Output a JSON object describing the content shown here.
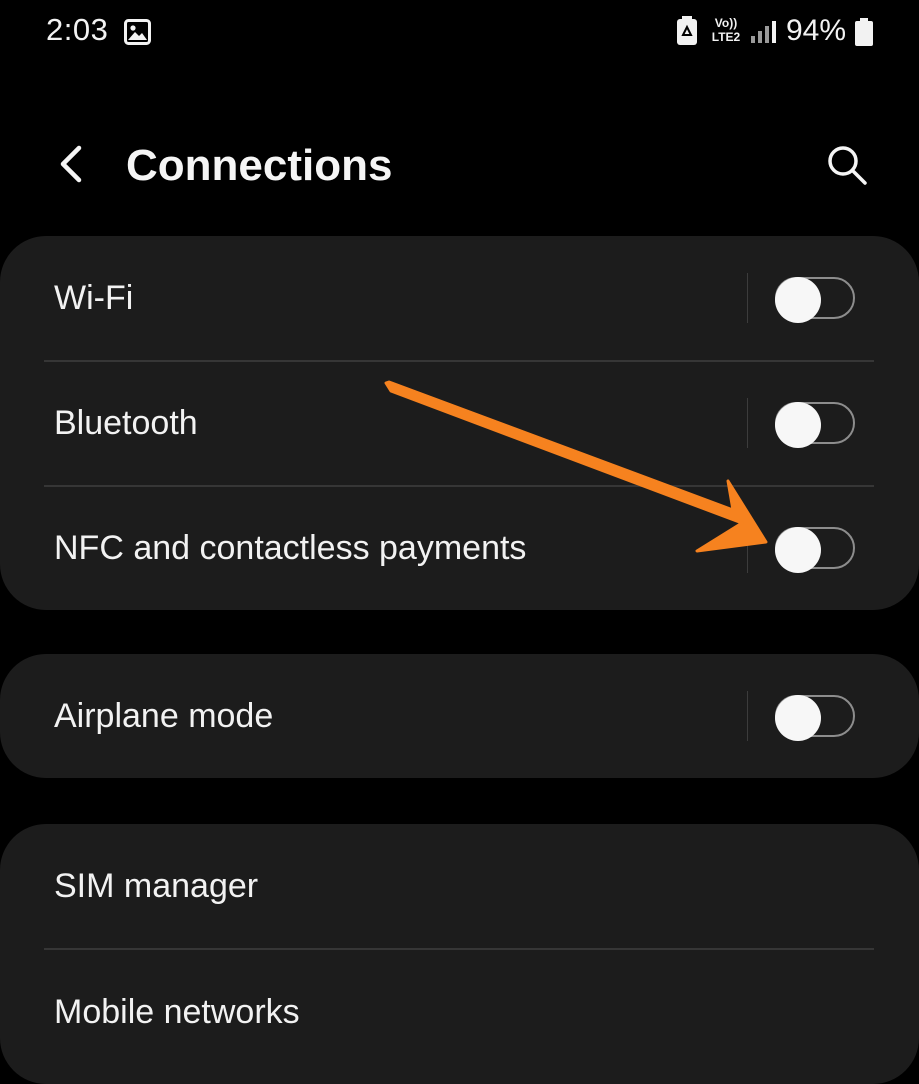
{
  "status_bar": {
    "time": "2:03",
    "network_label_top": "Vo))",
    "network_label_bottom": "LTE2",
    "battery_percent": "94%",
    "icons": [
      "gallery-icon",
      "battery-saver-icon",
      "signal-icon",
      "battery-icon"
    ]
  },
  "header": {
    "title": "Connections",
    "back_icon": "chevron-left-icon",
    "search_icon": "search-icon"
  },
  "groups": [
    {
      "items": [
        {
          "label": "Wi-Fi",
          "toggle": false
        },
        {
          "label": "Bluetooth",
          "toggle": false
        },
        {
          "label": "NFC and contactless payments",
          "toggle": false
        }
      ]
    },
    {
      "items": [
        {
          "label": "Airplane mode",
          "toggle": false
        }
      ]
    },
    {
      "items": [
        {
          "label": "SIM manager"
        },
        {
          "label": "Mobile networks"
        }
      ]
    }
  ],
  "annotation": {
    "type": "arrow",
    "color": "#f6821f",
    "target": "nfc-toggle"
  },
  "colors": {
    "background": "#000000",
    "card": "#1c1c1c",
    "text": "#f2f2f2",
    "divider": "#363636",
    "toggle_off_track": "#8d8d8d",
    "toggle_knob": "#f7f7f7"
  }
}
